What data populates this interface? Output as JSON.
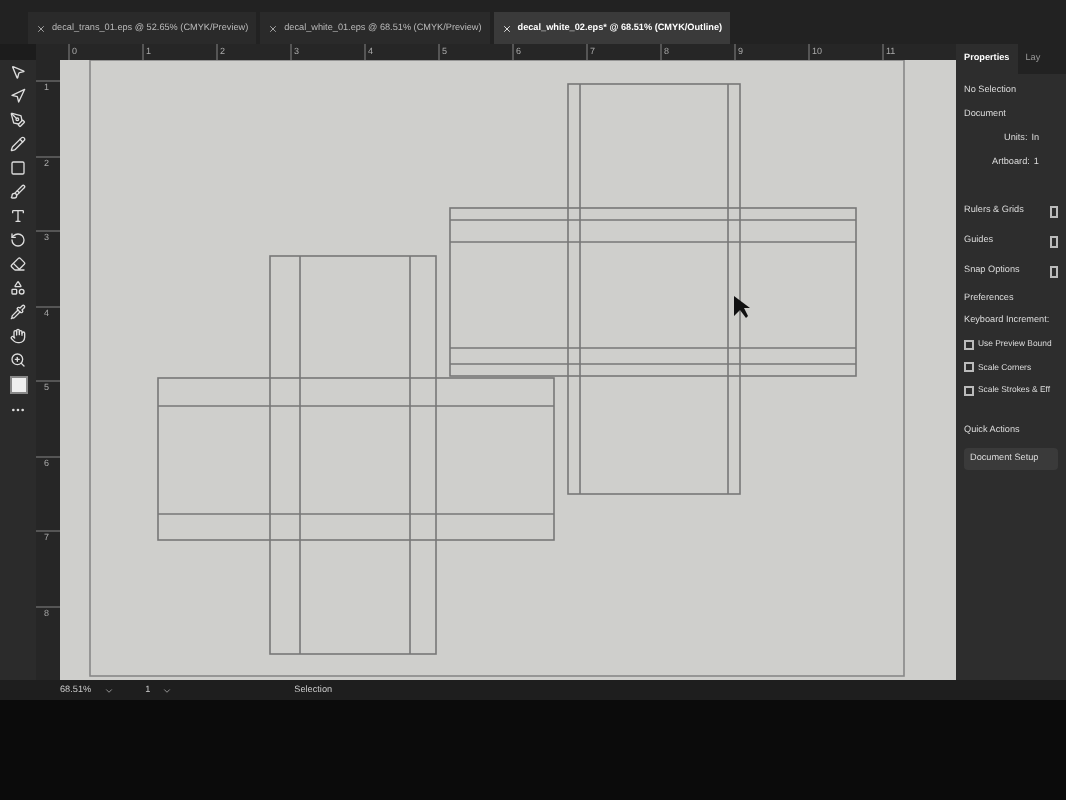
{
  "tabs": [
    {
      "label": "decal_trans_01.eps @ 52.65% (CMYK/Preview)",
      "selected": false
    },
    {
      "label": "decal_white_01.eps @ 68.51% (CMYK/Preview)",
      "selected": false
    },
    {
      "label": "decal_white_02.eps* @ 68.51% (CMYK/Outline)",
      "selected": true
    }
  ],
  "ruler": {
    "horizontal": [
      "0",
      "1",
      "2",
      "3",
      "4",
      "5",
      "6",
      "7",
      "8",
      "9",
      "10",
      "11"
    ],
    "vertical": [
      "1",
      "2",
      "3",
      "4",
      "5",
      "6",
      "7",
      "8"
    ]
  },
  "panel": {
    "tabs": [
      {
        "label": "Properties",
        "selected": true
      },
      {
        "label": "Lay",
        "selected": false
      }
    ],
    "selection": "No Selection",
    "document_heading": "Document",
    "units_label": "Units:",
    "units_value": "In",
    "artboard_label": "Artboard:",
    "artboard_value": "1",
    "sections": [
      "Rulers & Grids",
      "Guides",
      "Snap Options"
    ],
    "preferences_heading": "Preferences",
    "keyboard_increment_label": "Keyboard Increment:",
    "checkboxes": [
      {
        "label": "Use Preview Bound",
        "checked": false
      },
      {
        "label": "Scale Corners",
        "checked": false
      },
      {
        "label": "Scale Strokes & Eff",
        "checked": false
      }
    ],
    "quick_actions_heading": "Quick Actions",
    "document_setup_button": "Document Setup"
  },
  "status_bar": {
    "zoom": "68.51%",
    "artboard": "1",
    "tool": "Selection"
  }
}
